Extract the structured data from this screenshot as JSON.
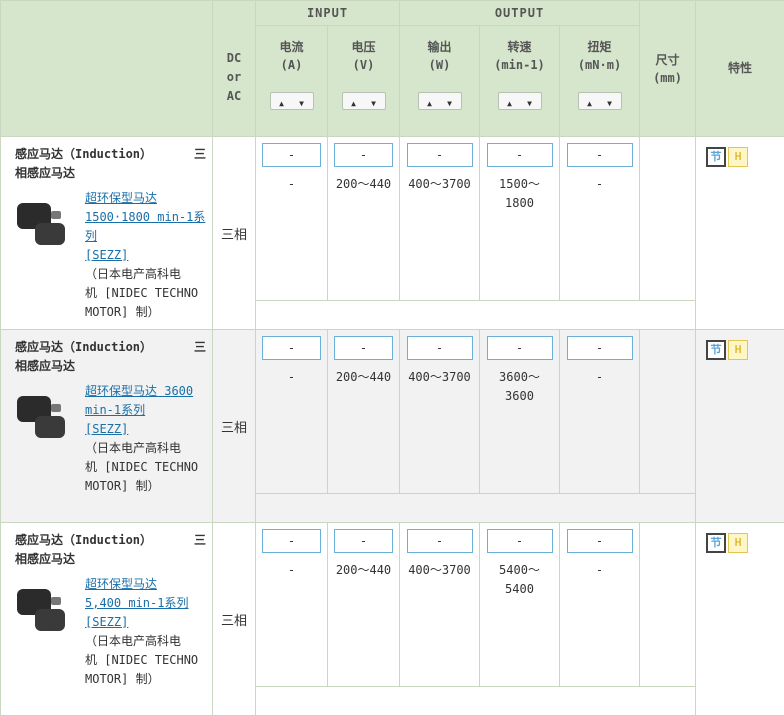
{
  "header": {
    "input_group": "INPUT",
    "output_group": "OUTPUT",
    "dc_ac": [
      "DC",
      "or",
      "AC"
    ],
    "current": [
      "电流",
      "(A)"
    ],
    "voltage": [
      "电压",
      "(V)"
    ],
    "output_power": [
      "输出",
      "(W)"
    ],
    "speed": [
      "转速",
      "(min-1)"
    ],
    "torque": [
      "扭矩",
      "(mN·m)"
    ],
    "size": [
      "尺寸",
      "(mm)"
    ],
    "feature": "特性",
    "sort_up": "▲",
    "sort_down": "▼"
  },
  "filter_placeholder": "-",
  "products": [
    {
      "category_left": "感应马达（Induction）",
      "category_right": "三",
      "category_line2": "相感应马达",
      "link": [
        "超环保型马达",
        "1500·1800 min-1系",
        "列",
        "[SEZZ]"
      ],
      "maker": [
        "（日本电产高科电",
        "机 [NIDEC TECHNO",
        "MOTOR] 制）"
      ],
      "phase": "三相",
      "current": "-",
      "voltage": "200～440",
      "output": "400～3700",
      "speed": [
        "1500～",
        "1800"
      ],
      "torque": "-",
      "badges": [
        "节",
        "H"
      ]
    },
    {
      "category_left": "感应马达（Induction）",
      "category_right": "三",
      "category_line2": "相感应马达",
      "link": [
        "超环保型马达 3600",
        "min-1系列",
        "[SEZZ]"
      ],
      "maker": [
        "（日本电产高科电",
        "机 [NIDEC TECHNO",
        "MOTOR] 制）"
      ],
      "phase": "三相",
      "current": "-",
      "voltage": "200～440",
      "output": "400～3700",
      "speed": [
        "3600～",
        "3600"
      ],
      "torque": "-",
      "badges": [
        "节",
        "H"
      ]
    },
    {
      "category_left": "感应马达（Induction）",
      "category_right": "三",
      "category_line2": "相感应马达",
      "link": [
        "超环保型马达",
        "5,400 min-1系列",
        "[SEZZ]"
      ],
      "maker": [
        "（日本电产高科电",
        "机 [NIDEC TECHNO",
        "MOTOR] 制）"
      ],
      "phase": "三相",
      "current": "-",
      "voltage": "200～440",
      "output": "400～3700",
      "speed": [
        "5400～",
        "5400"
      ],
      "torque": "-",
      "badges": [
        "节",
        "H"
      ]
    }
  ]
}
